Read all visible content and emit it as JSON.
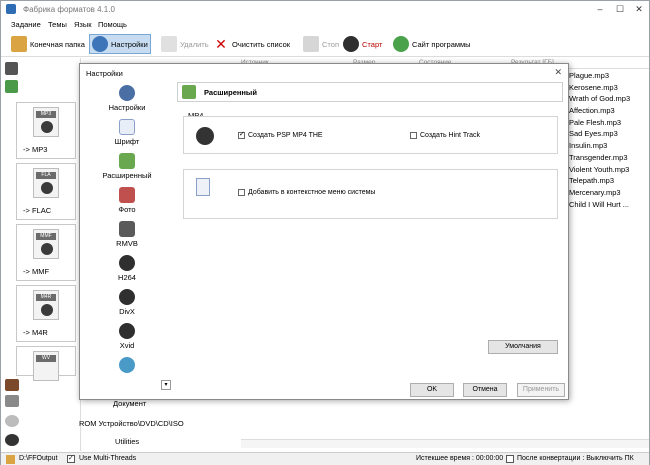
{
  "window": {
    "title": "Фабрика форматов 4.1.0"
  },
  "menu": [
    "Задание",
    "Темы",
    "Язык",
    "Помощь"
  ],
  "toolbar": {
    "output_folder": "Конечная папка",
    "settings": "Настройки",
    "delete": "Удалить",
    "clear_list": "Очистить список",
    "stop": "Стоп",
    "start": "Старт",
    "website": "Сайт программы"
  },
  "formats": [
    "-> MP3",
    "-> FLAC",
    "-> MMF",
    "-> M4R",
    ""
  ],
  "format_tags": [
    "MP3",
    "FLA",
    "MMF",
    "M4R",
    "WV"
  ],
  "left_bottom": {
    "document": "Документ",
    "rom": "ROM Устройство\\DVD\\CD\\ISO",
    "utilities": "Utilities"
  },
  "list": {
    "columns": [
      "Источник",
      "Размер",
      "Состояние",
      "Результат [ГБ]"
    ],
    "files": [
      "Plague.mp3",
      "Kerosene.mp3",
      "Wrath of God.mp3",
      "Affection.mp3",
      "Pale Flesh.mp3",
      "Sad Eyes.mp3",
      "Insulin.mp3",
      "Transgender.mp3",
      "Violent Youth.mp3",
      "Telepath.mp3",
      "Mercenary.mp3",
      "Child I Will Hurt ..."
    ]
  },
  "statusbar": {
    "output": "D:\\FFOutput",
    "multithreads": "Use Multi-Threads",
    "elapsed": "Истекшее время : 00:00:00",
    "after_convert": "После конвертации : Выключить ПК"
  },
  "dialog": {
    "title": "Настройки",
    "close": "✕",
    "categories": [
      "Настройки",
      "Шрифт",
      "Расширенный",
      "Фото",
      "RMVB",
      "H264",
      "DivX",
      "Xvid",
      ""
    ],
    "panel_title": "Расширенный",
    "group_label": "MP4",
    "opt_psp": "Создать PSP MP4 THE",
    "opt_hint": "Создать Hint Track",
    "opt_context": "Добавить в контекстное меню системы",
    "defaults": "Умолчания",
    "ok": "OK",
    "cancel": "Отмена",
    "apply": "Применить",
    "scroll_down": "▾"
  },
  "colors": {
    "accent": "#2e6db3",
    "selected_tool": "#c7dcf0"
  }
}
